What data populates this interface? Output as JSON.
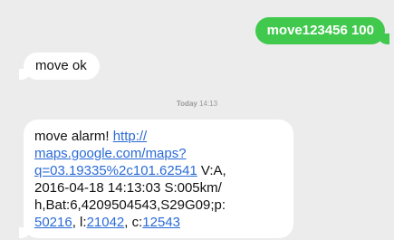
{
  "thread": {
    "outgoing": {
      "text": "move123456 100"
    },
    "incoming_ack": {
      "text": "move ok"
    },
    "timestamp": {
      "day": "Today",
      "time": "14:13"
    },
    "alarm_message": {
      "prefix": "move alarm! ",
      "link_line1": "http://",
      "link_line2": "maps.google.com/maps?",
      "link_line3": "q=03.19335%2c101.62541",
      "after_link": " V:A,",
      "line_date": "2016-04-18 14:13:03 S:005km/",
      "line_bat": "h,Bat:6,4209504543,S29G09;p:",
      "p_value": "50216",
      "l_sep": ", l:",
      "l_value": "21042",
      "c_sep": ", c:",
      "c_value": "12543"
    }
  },
  "colors": {
    "background": "#ececec",
    "outgoing_bubble": "#41c94e",
    "incoming_bubble": "#ffffff",
    "link": "#2a6bd6"
  }
}
